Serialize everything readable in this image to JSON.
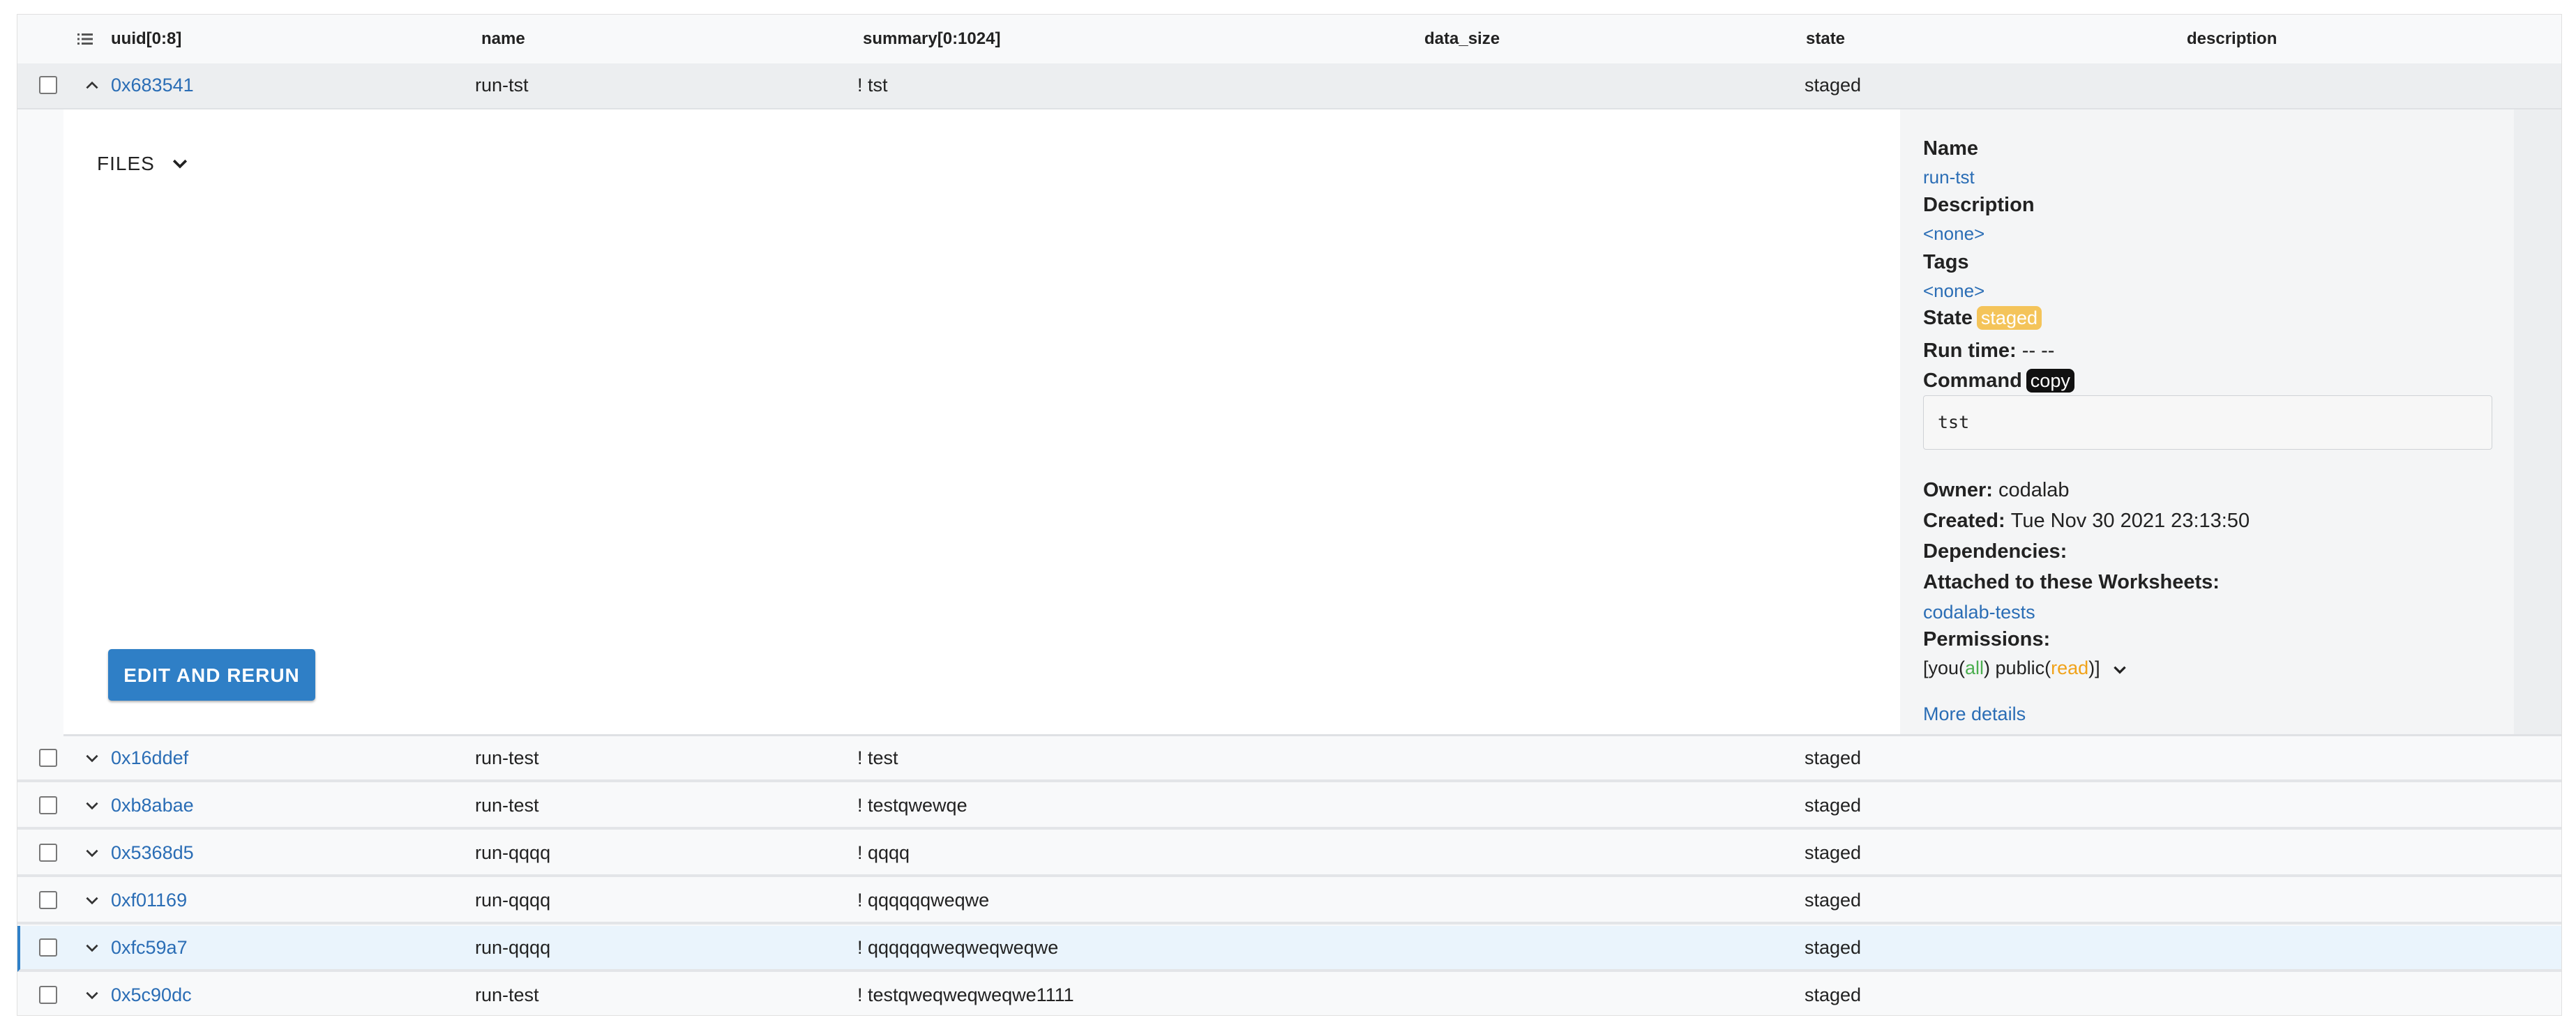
{
  "headers": [
    "uuid[0:8]",
    "name",
    "summary[0:1024]",
    "data_size",
    "state",
    "description"
  ],
  "expanded_row": {
    "uuid": "0x683541",
    "name": "run-tst",
    "summary": "! tst",
    "state": "staged"
  },
  "files_label": "FILES",
  "rerun_label": "EDIT AND RERUN",
  "side": {
    "name_label": "Name",
    "name_value": "run-tst",
    "description_label": "Description",
    "description_value": "<none>",
    "tags_label": "Tags",
    "tags_value": "<none>",
    "state_label": "State",
    "state_value": "staged",
    "runtime_label": "Run time:",
    "runtime_value": "-- --",
    "command_label": "Command",
    "copy_label": "copy",
    "command_value": "tst",
    "owner_label": "Owner:",
    "owner_value": "codalab",
    "created_label": "Created:",
    "created_value": "Tue Nov 30 2021 23:13:50",
    "dependencies_label": "Dependencies:",
    "worksheets_label": "Attached to these Worksheets:",
    "worksheets_value": "codalab-tests",
    "permissions_label": "Permissions:",
    "perm_prefix": "[you(",
    "perm_all": "all",
    "perm_mid": ") public(",
    "perm_read": "read",
    "perm_suffix": ")]",
    "more_details": "More details"
  },
  "rows": [
    {
      "uuid": "0x16ddef",
      "name": "run-test",
      "summary": "! test",
      "state": "staged"
    },
    {
      "uuid": "0xb8abae",
      "name": "run-test",
      "summary": "! testqwewqe",
      "state": "staged"
    },
    {
      "uuid": "0x5368d5",
      "name": "run-qqqq",
      "summary": "! qqqq",
      "state": "staged"
    },
    {
      "uuid": "0xf01169",
      "name": "run-qqqq",
      "summary": "! qqqqqqweqwe",
      "state": "staged"
    },
    {
      "uuid": "0xfc59a7",
      "name": "run-qqqq",
      "summary": "! qqqqqqweqweqweqwe",
      "state": "staged"
    },
    {
      "uuid": "0x5c90dc",
      "name": "run-test",
      "summary": "! testqweqweqweqwe1111",
      "state": "staged"
    }
  ],
  "colors": {
    "link": "#2a6db5",
    "accent": "#2f7fc6",
    "staged_badge": "#f4c45a"
  }
}
